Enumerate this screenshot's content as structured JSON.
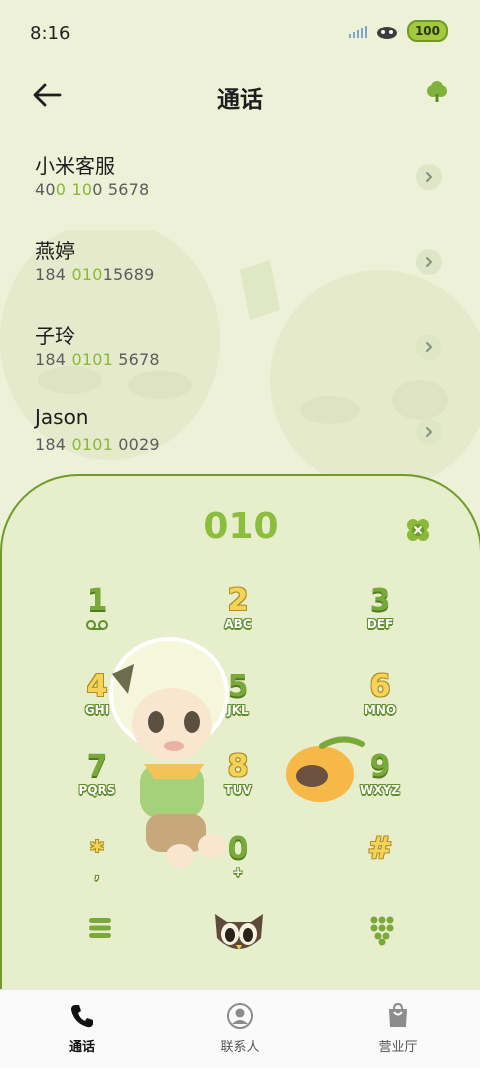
{
  "status_bar": {
    "time": "8:16",
    "battery": "100"
  },
  "header": {
    "title": "通话"
  },
  "contacts": [
    {
      "name": "小米客服",
      "number_parts": [
        "40",
        "0",
        " ",
        "10",
        "0 5678"
      ]
    },
    {
      "name": "燕婷",
      "number_parts": [
        "184 ",
        "010",
        "15689",
        "",
        ""
      ]
    },
    {
      "name": "子玲",
      "number_parts": [
        "184 ",
        "0101",
        " 5678",
        "",
        ""
      ]
    },
    {
      "name": "Jason",
      "number_parts": [
        "184 ",
        "0101",
        " 0029",
        "",
        ""
      ]
    }
  ],
  "dialpad": {
    "input": "010",
    "keys": [
      {
        "digit": "1",
        "letters": ""
      },
      {
        "digit": "2",
        "letters": "ABC"
      },
      {
        "digit": "3",
        "letters": "DEF"
      },
      {
        "digit": "4",
        "letters": "GHI"
      },
      {
        "digit": "5",
        "letters": "JKL"
      },
      {
        "digit": "6",
        "letters": "MNO"
      },
      {
        "digit": "7",
        "letters": "PQRS"
      },
      {
        "digit": "8",
        "letters": "TUV"
      },
      {
        "digit": "9",
        "letters": "WXYZ"
      },
      {
        "digit": "*",
        "letters": ","
      },
      {
        "digit": "0",
        "letters": "+"
      },
      {
        "digit": "#",
        "letters": ""
      }
    ]
  },
  "bottom_nav": [
    {
      "label": "通话",
      "icon": "phone-icon",
      "active": true
    },
    {
      "label": "联系人",
      "icon": "person-icon",
      "active": false
    },
    {
      "label": "营业厅",
      "icon": "shopping-bag-icon",
      "active": false
    }
  ],
  "colors": {
    "accent": "#8cbd3c",
    "border": "#6e9b2a",
    "background": "#ecf1d8"
  }
}
